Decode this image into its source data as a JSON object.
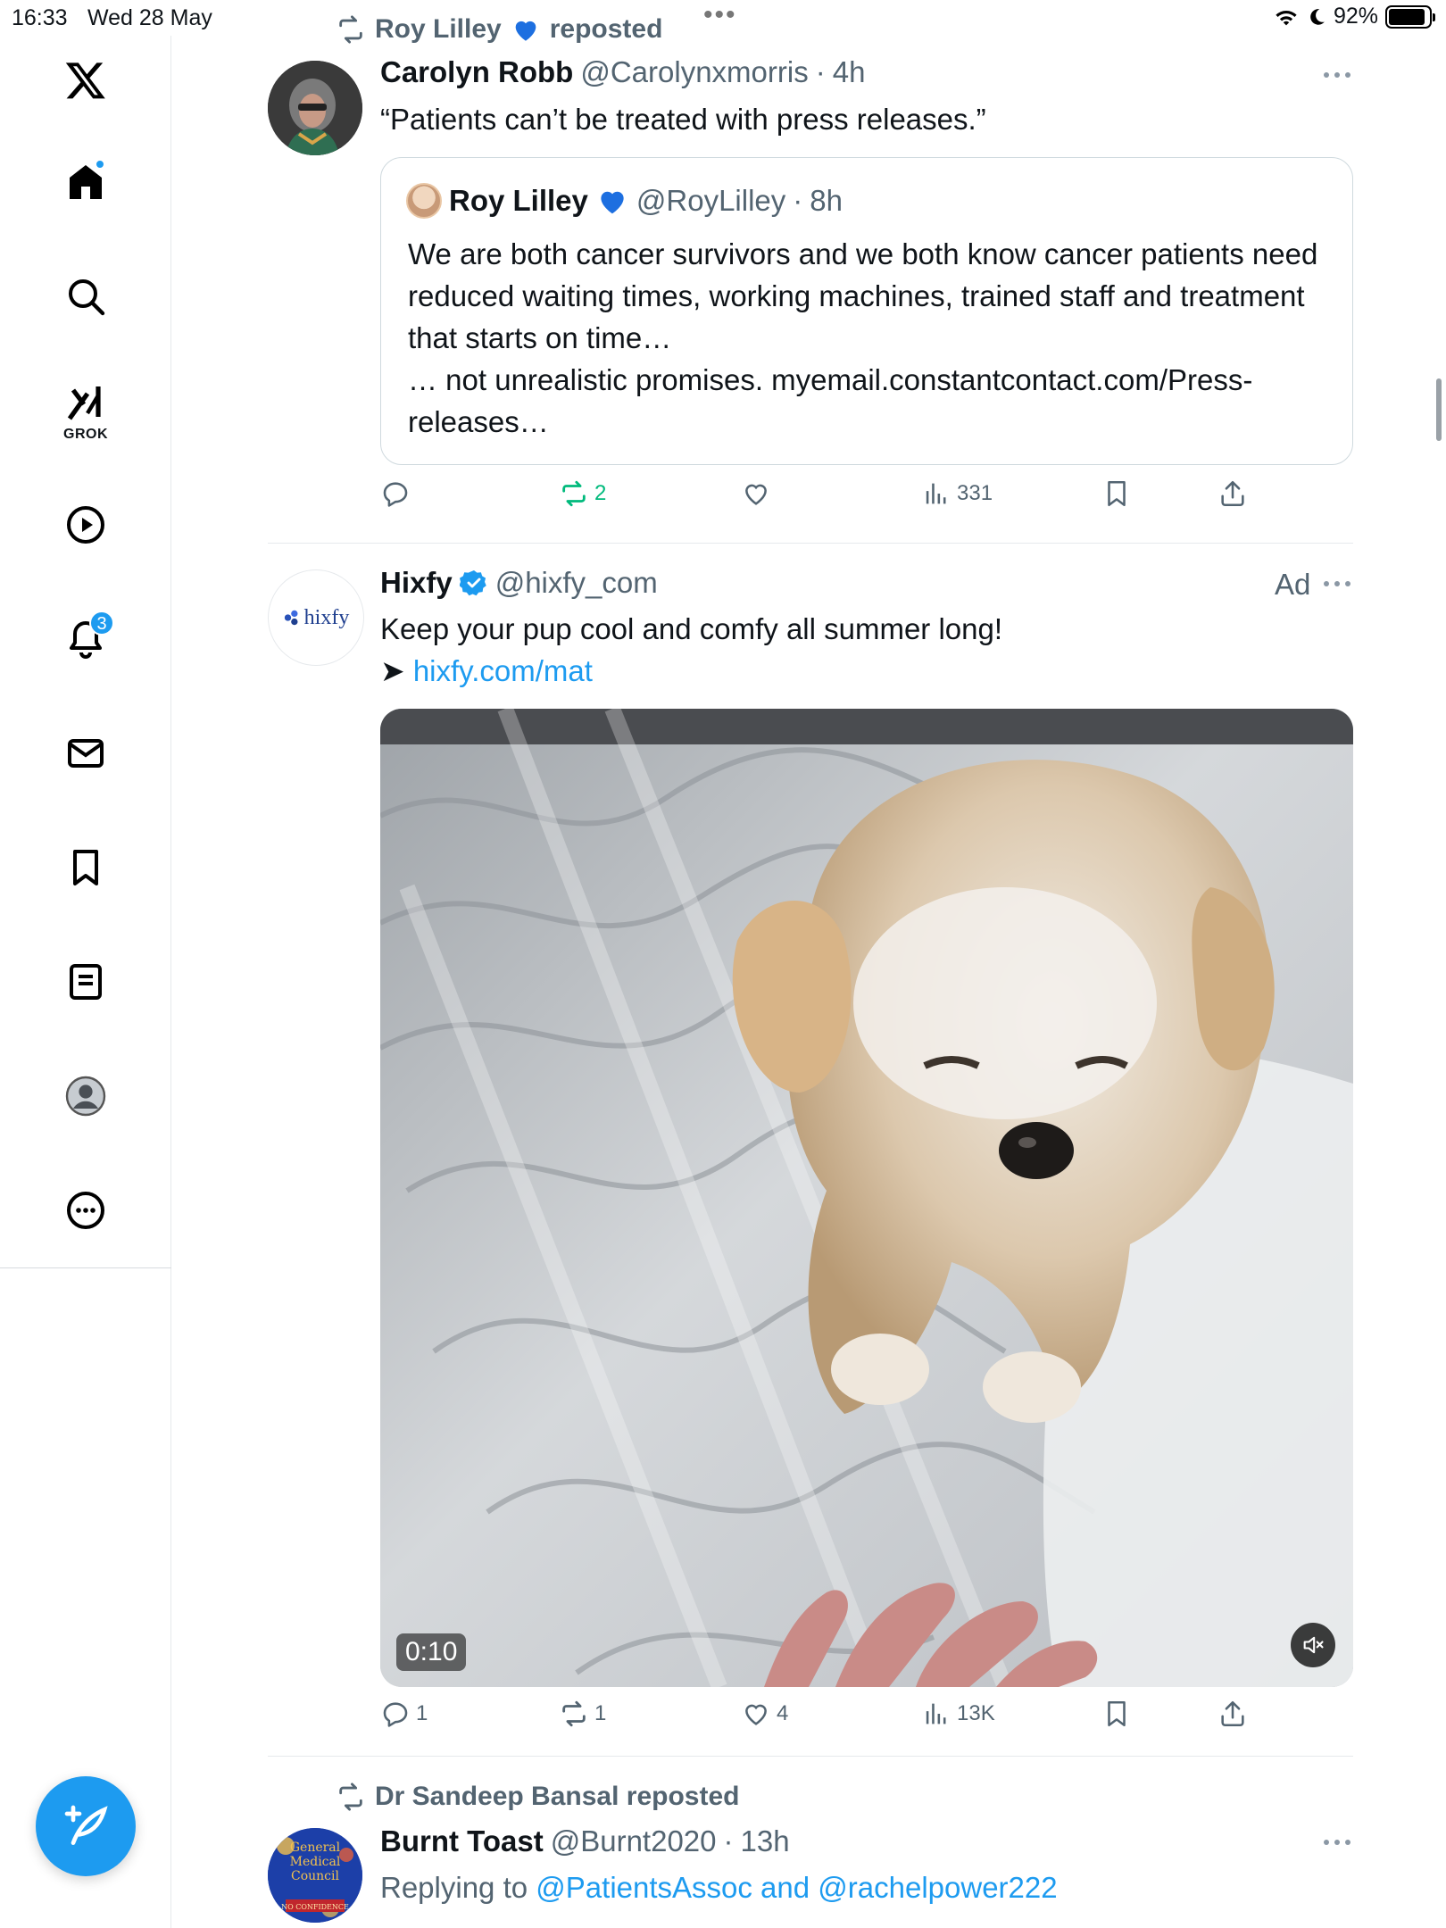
{
  "status_bar": {
    "time": "16:33",
    "date": "Wed 28 May",
    "battery": "92%",
    "battery_level": 0.92
  },
  "sidebar": {
    "items": [
      {
        "name": "x-logo"
      },
      {
        "name": "home",
        "active": true
      },
      {
        "name": "search"
      },
      {
        "name": "grok",
        "label": "GROK"
      },
      {
        "name": "video"
      },
      {
        "name": "notifications",
        "badge": "3"
      },
      {
        "name": "messages"
      },
      {
        "name": "bookmarks"
      },
      {
        "name": "lists"
      },
      {
        "name": "profile"
      },
      {
        "name": "more"
      }
    ]
  },
  "tweets": [
    {
      "social_context": "Roy Lilley",
      "social_context_suffix": "reposted",
      "name": "Carolyn Robb",
      "handle": "@Carolynxmorris",
      "sep": "·",
      "time": "4h",
      "text": "“Patients can’t be treated with press releases.”",
      "quote": {
        "name": "Roy Lilley",
        "handle": "@RoyLilley",
        "sep": "·",
        "time": "8h",
        "text": "We are both cancer survivors and we both know cancer patients need reduced waiting times, working machines, trained staff and treatment that starts on time…",
        "text2": "… not unrealistic promises.  myemail.constantcontact.com/Press-releases…"
      },
      "actions": {
        "replies": "",
        "reposts": "2",
        "likes": "",
        "views": "331"
      }
    },
    {
      "name": "Hixfy",
      "handle": "@hixfy_com",
      "ad_label": "Ad",
      "avatar_text": "hixfy",
      "text": "Keep your pup cool and comfy all summer long!",
      "arrow": "➤",
      "link": "hixfy.com/mat",
      "media": {
        "type": "video",
        "duration": "0:10"
      },
      "actions": {
        "replies": "1",
        "reposts": "1",
        "likes": "4",
        "views": "13K"
      }
    },
    {
      "social_context": "Dr Sandeep Bansal reposted",
      "name": "Burnt Toast",
      "handle": "@Burnt2020",
      "sep": "·",
      "time": "13h",
      "replying_prefix": "Replying to",
      "replying_to": "@PatientsAssoc and @rachelpower222",
      "avatar_text": [
        "General",
        "Medical",
        "Council",
        "NO CONFIDENCE"
      ]
    }
  ]
}
